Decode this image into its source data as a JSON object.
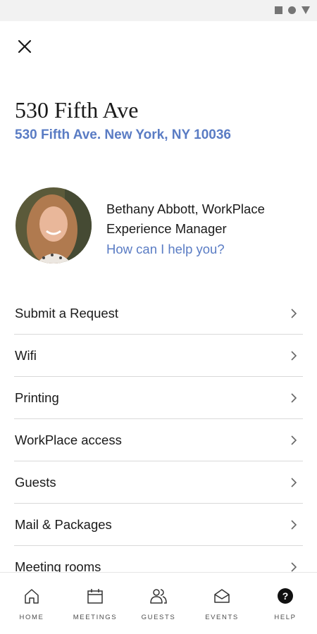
{
  "status_bar": {
    "icons": [
      "square-icon",
      "circle-icon",
      "triangle-icon"
    ]
  },
  "header": {
    "close_icon": "close-icon"
  },
  "location": {
    "title": "530 Fifth Ave",
    "address": "530 Fifth Ave. New York, NY 10036"
  },
  "contact": {
    "name": "Bethany Abbott, WorkPlace Experience Manager",
    "link": "How can I help you?"
  },
  "menu": {
    "items": [
      {
        "label": "Submit a Request"
      },
      {
        "label": "Wifi"
      },
      {
        "label": "Printing"
      },
      {
        "label": "WorkPlace access"
      },
      {
        "label": "Guests"
      },
      {
        "label": "Mail & Packages"
      },
      {
        "label": "Meeting rooms"
      }
    ]
  },
  "bottom_nav": {
    "items": [
      {
        "label": "HOME",
        "icon": "home-icon"
      },
      {
        "label": "MEETINGS",
        "icon": "calendar-icon"
      },
      {
        "label": "GUESTS",
        "icon": "people-icon"
      },
      {
        "label": "EVENTS",
        "icon": "envelope-icon"
      },
      {
        "label": "HELP",
        "icon": "help-icon"
      }
    ],
    "active": "HELP"
  },
  "colors": {
    "accent": "#5a7cc4",
    "text": "#1a1a1a",
    "divider": "#d9d9d9"
  }
}
